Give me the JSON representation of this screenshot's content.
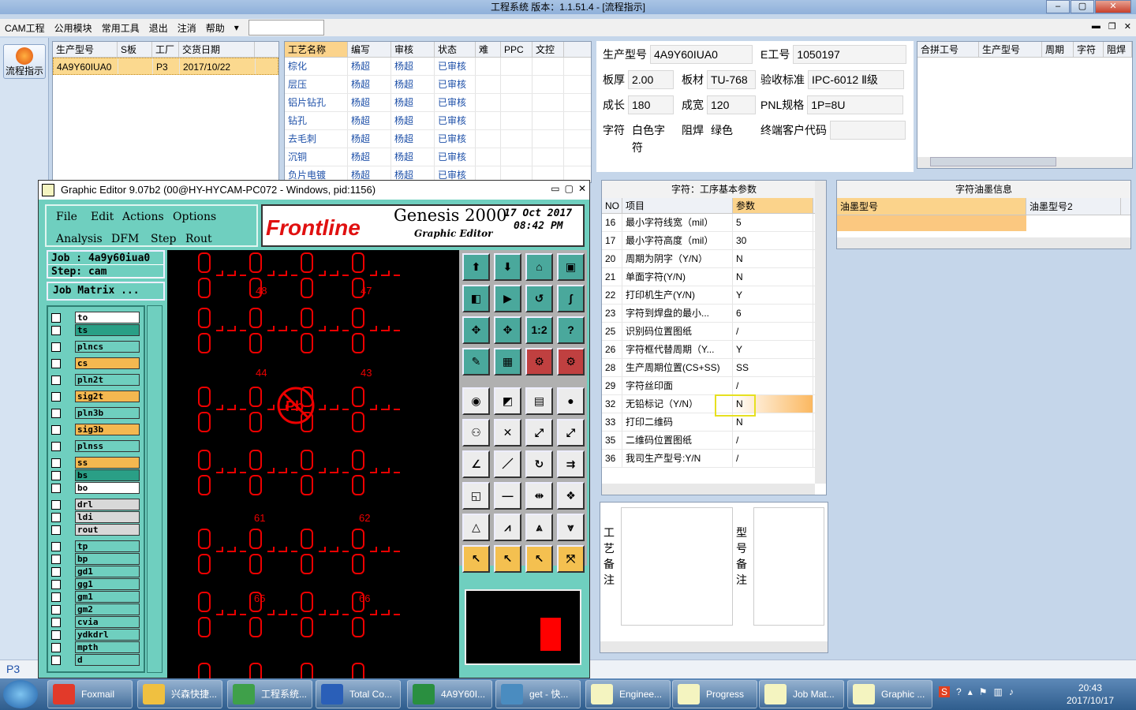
{
  "window": {
    "title": "工程系统  版本：1.1.51.4 - [流程指示]"
  },
  "menu": [
    "CAM工程",
    "公用模块",
    "常用工具",
    "退出",
    "注消",
    "帮助"
  ],
  "flow_button": "流程指示",
  "order_table": {
    "headers": [
      "生产型号",
      "S板",
      "工厂",
      "交货日期"
    ],
    "row": [
      "4A9Y60IUA0",
      "",
      "P3",
      "2017/10/22"
    ]
  },
  "process_table": {
    "headers": [
      "工艺名称",
      "编写",
      "审核",
      "状态",
      "难",
      "PPC",
      "文控"
    ],
    "rows": [
      [
        "棕化",
        "杨超",
        "杨超",
        "已审核"
      ],
      [
        "层压",
        "杨超",
        "杨超",
        "已审核"
      ],
      [
        "铝片钻孔",
        "杨超",
        "杨超",
        "已审核"
      ],
      [
        "钻孔",
        "杨超",
        "杨超",
        "已审核"
      ],
      [
        "去毛刺",
        "杨超",
        "杨超",
        "已审核"
      ],
      [
        "沉铜",
        "杨超",
        "杨超",
        "已审核"
      ],
      [
        "负片电镀",
        "杨超",
        "杨超",
        "已审核"
      ]
    ]
  },
  "info": {
    "prod_model_label": "生产型号",
    "prod_model": "4A9Y60IUA0",
    "e_label": "E工号",
    "e_no": "1050197",
    "thick_label": "板厚",
    "thick": "2.00",
    "mat_label": "板材",
    "mat": "TU-768",
    "std_label": "验收标准",
    "std": "IPC-6012 Ⅱ级",
    "len_label": "成长",
    "len": "180",
    "wid_label": "成宽",
    "wid": "120",
    "pnl_label": "PNL规格",
    "pnl": "1P=8U",
    "char_label": "字符",
    "char": "白色字符",
    "mask_label": "阻焊",
    "mask": "绿色",
    "cust_label": "终端客户代码",
    "cust": ""
  },
  "merge_table": {
    "headers": [
      "合拼工号",
      "生产型号",
      "周期",
      "字符",
      "阻焊"
    ]
  },
  "param": {
    "title": "字符：工序基本参数",
    "headers": [
      "NO",
      "项目",
      "参数"
    ],
    "rows": [
      [
        "16",
        "最小字符线宽（mil）",
        "5"
      ],
      [
        "17",
        "最小字符高度（mil）",
        "30"
      ],
      [
        "20",
        "周期为阴字（Y/N）",
        "N"
      ],
      [
        "21",
        "单面字符(Y/N)",
        "N"
      ],
      [
        "22",
        "打印机生产(Y/N)",
        "Y"
      ],
      [
        "23",
        "字符到焊盘的最小...",
        "6"
      ],
      [
        "25",
        "识别码位置图纸",
        "/"
      ],
      [
        "26",
        "字符框代替周期（Y...",
        "Y"
      ],
      [
        "28",
        "生产周期位置(CS+SS)",
        "SS"
      ],
      [
        "29",
        "字符丝印面",
        "/"
      ],
      [
        "32",
        "无铅标记（Y/N）",
        "N"
      ],
      [
        "33",
        "打印二维码",
        "N"
      ],
      [
        "35",
        "二维码位置图纸",
        "/"
      ],
      [
        "36",
        "我司生产型号:Y/N",
        "/"
      ]
    ]
  },
  "ink": {
    "title": "字符油墨信息",
    "headers": [
      "油墨型号",
      "油墨型号2"
    ]
  },
  "notes": {
    "proc": "工艺备注",
    "model": "型号备注"
  },
  "ge": {
    "title": "Graphic Editor 9.07b2 (00@HY-HYCAM-PC072 - Windows, pid:1156)",
    "menu1": [
      "File",
      "Edit",
      "Actions",
      "Options"
    ],
    "menu2": [
      "Analysis",
      "DFM",
      "Step",
      "Rout"
    ],
    "brand": "Frontline",
    "product": "Genesis 2000",
    "subtitle": "Graphic Editor",
    "date": "17 Oct 2017",
    "time": "08:42 PM",
    "job": "Job : 4a9y60iua0",
    "step": "Step: cam",
    "matrix": "Job Matrix ...",
    "layers": [
      "to",
      "ts",
      "plncs",
      "cs",
      "pln2t",
      "sig2t",
      "pln3b",
      "sig3b",
      "plnss",
      "ss",
      "bs",
      "bo",
      "drl",
      "ldi",
      "rout",
      "tp",
      "bp",
      "gd1",
      "gg1",
      "gm1",
      "gm2",
      "cvia",
      "ydkdrl",
      "mpth",
      "d"
    ],
    "numbers": [
      "48",
      "47",
      "44",
      "43",
      "61",
      "62",
      "65",
      "66"
    ]
  },
  "status": {
    "site": "P3"
  },
  "taskbar": [
    "Foxmail",
    "兴森快捷...",
    "工程系统...",
    "Total Co...",
    "4A9Y60I...",
    "get - 快...",
    "Enginee...",
    "Progress",
    "Job Mat...",
    "Graphic ..."
  ],
  "clock": {
    "time": "20:43",
    "date": "2017/10/17"
  }
}
